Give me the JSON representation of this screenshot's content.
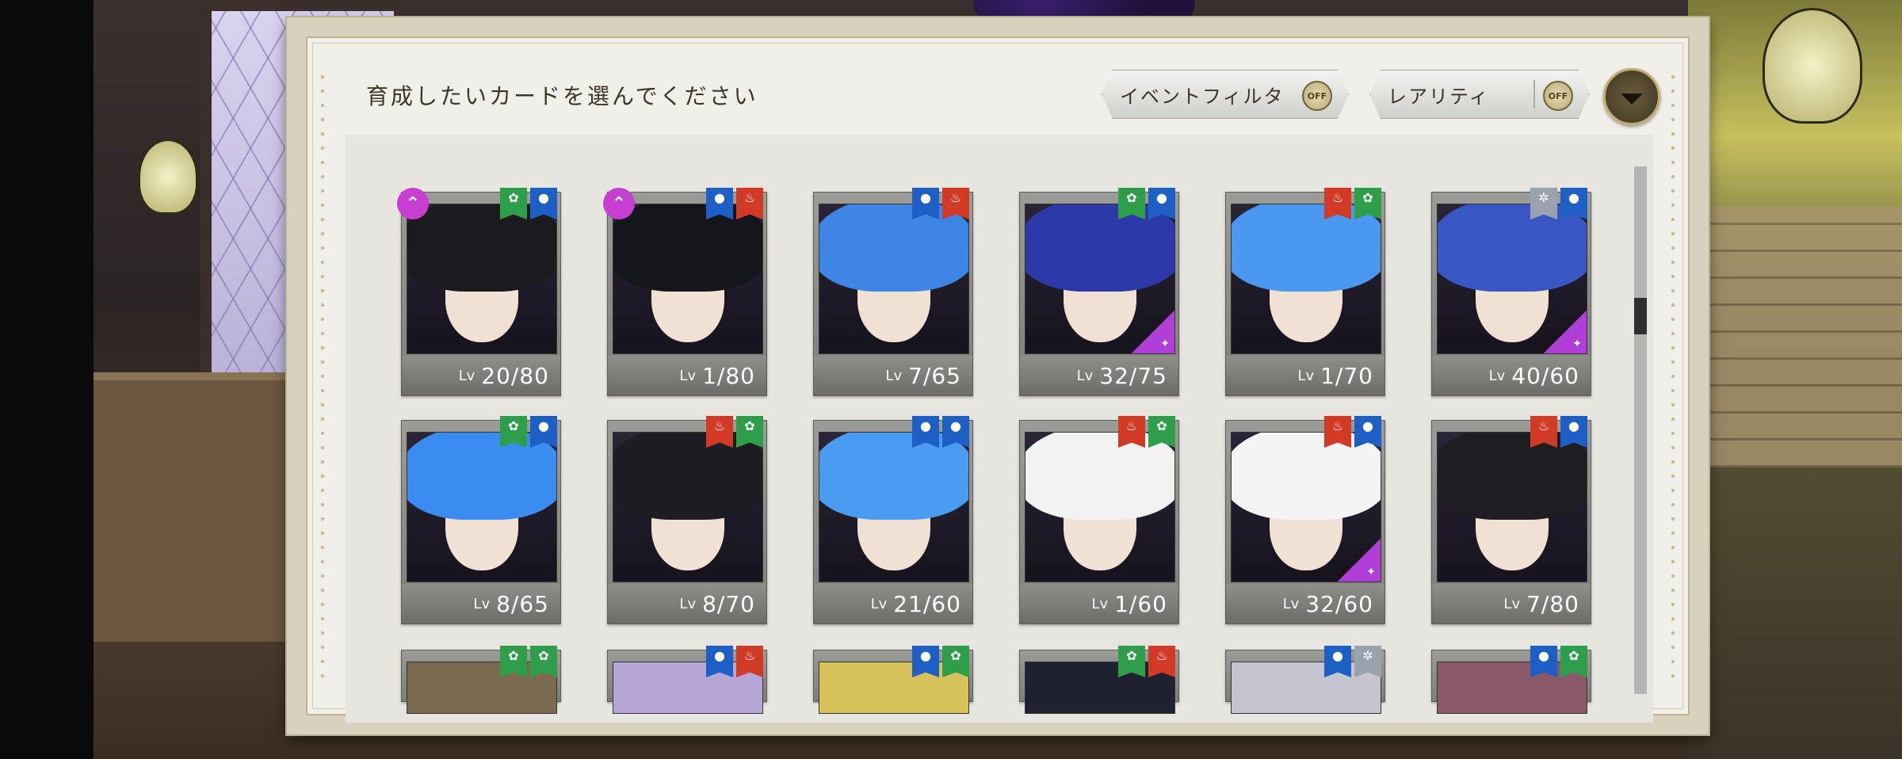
{
  "dialog": {
    "title": "育成したいカードを選んでください",
    "event_filter": {
      "label": "イベントフィルタ",
      "state": "OFF"
    },
    "rarity_filter": {
      "label": "レアリティ",
      "state": "OFF"
    },
    "sort_icon": "chevron-down-icon"
  },
  "colors": {
    "green": "#2e9e4a",
    "blue": "#1d5fc4",
    "red": "#d23a26",
    "grey": "#9aa3ad",
    "purple": "#c73fd0"
  },
  "level_prefix": "Lv",
  "cards": [
    {
      "level": "20/80",
      "badges": [
        "green",
        "blue"
      ],
      "up": true,
      "rare": false,
      "hair": "#1a1a1f"
    },
    {
      "level": "1/80",
      "badges": [
        "blue",
        "red"
      ],
      "up": true,
      "rare": false,
      "hair": "#15161c"
    },
    {
      "level": "7/65",
      "badges": [
        "blue",
        "red"
      ],
      "up": false,
      "rare": false,
      "hair": "#3e85e6"
    },
    {
      "level": "32/75",
      "badges": [
        "green",
        "blue"
      ],
      "up": false,
      "rare": true,
      "hair": "#2b3aa8"
    },
    {
      "level": "1/70",
      "badges": [
        "red",
        "green"
      ],
      "up": false,
      "rare": false,
      "hair": "#4a98f0"
    },
    {
      "level": "40/60",
      "badges": [
        "grey",
        "blue"
      ],
      "up": false,
      "rare": true,
      "hair": "#3a56c4"
    },
    {
      "level": "8/65",
      "badges": [
        "green",
        "blue"
      ],
      "up": false,
      "rare": false,
      "hair": "#3b8cf0"
    },
    {
      "level": "8/70",
      "badges": [
        "red",
        "green"
      ],
      "up": false,
      "rare": false,
      "hair": "#1c1c22"
    },
    {
      "level": "21/60",
      "badges": [
        "blue",
        "blue"
      ],
      "up": false,
      "rare": false,
      "hair": "#4a9bf2"
    },
    {
      "level": "1/60",
      "badges": [
        "red",
        "green"
      ],
      "up": false,
      "rare": false,
      "hair": "#f2f2f2"
    },
    {
      "level": "32/60",
      "badges": [
        "red",
        "blue"
      ],
      "up": false,
      "rare": true,
      "hair": "#f4f4f6"
    },
    {
      "level": "7/80",
      "badges": [
        "red",
        "blue"
      ],
      "up": false,
      "rare": false,
      "hair": "#1d1d22"
    }
  ],
  "partial_cards": [
    {
      "badges": [
        "green",
        "green"
      ],
      "hair": "#7a6a50"
    },
    {
      "badges": [
        "blue",
        "red"
      ],
      "hair": "#b6a6d6"
    },
    {
      "badges": [
        "blue",
        "green"
      ],
      "hair": "#d7c15a"
    },
    {
      "badges": [
        "green",
        "red"
      ],
      "hair": "#1f2130"
    },
    {
      "badges": [
        "blue",
        "grey"
      ],
      "hair": "#c5c5d2"
    },
    {
      "badges": [
        "blue",
        "green"
      ],
      "hair": "#8b5a6a"
    }
  ]
}
